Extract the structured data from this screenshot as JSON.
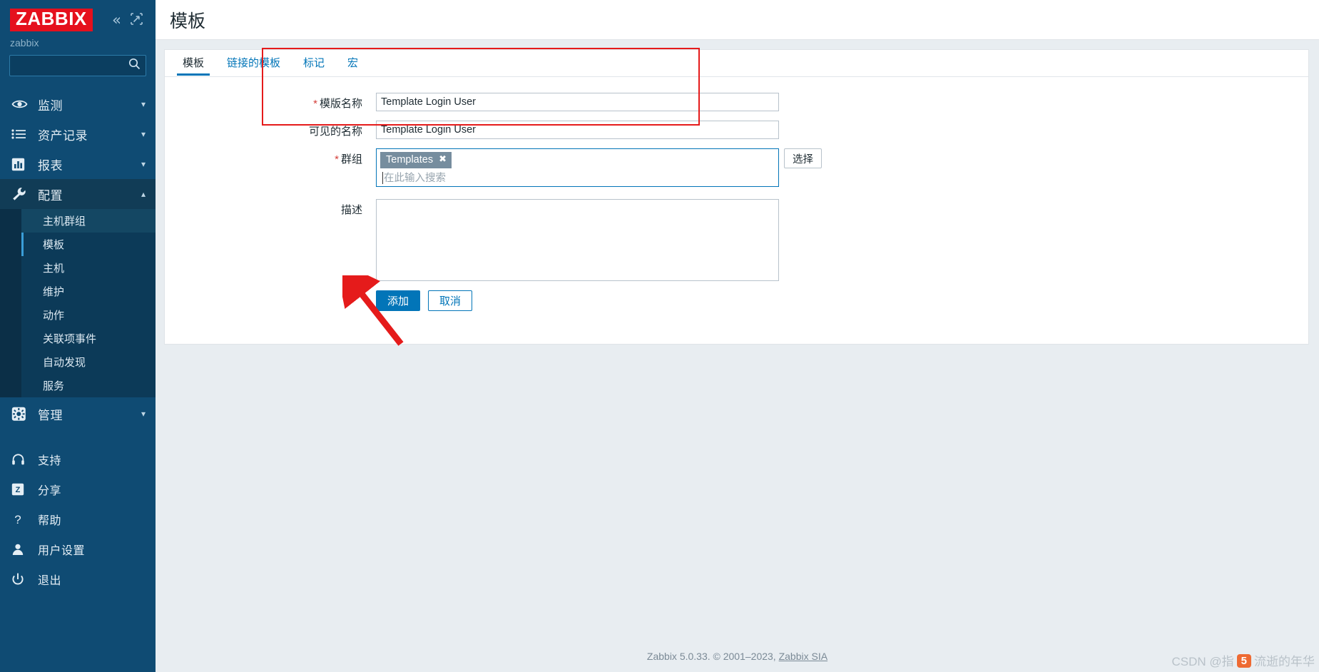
{
  "sidebar": {
    "logo_text": "ZABBIX",
    "collapse_icon": "chevrons-left-icon",
    "expand_icon": "expand-icon",
    "user_label": "zabbix",
    "search_placeholder": "",
    "search_value": "",
    "nav": [
      {
        "label": "监测",
        "icon": "eye-icon",
        "chevron": "chevron-down",
        "active": false
      },
      {
        "label": "资产记录",
        "icon": "list-icon",
        "chevron": "chevron-down",
        "active": false
      },
      {
        "label": "报表",
        "icon": "chart-icon",
        "chevron": "chevron-down",
        "active": false
      },
      {
        "label": "配置",
        "icon": "wrench-icon",
        "chevron": "chevron-up",
        "active": true
      }
    ],
    "subnav": [
      {
        "label": "主机群组",
        "state": "hover"
      },
      {
        "label": "模板",
        "state": "selected"
      },
      {
        "label": "主机",
        "state": ""
      },
      {
        "label": "维护",
        "state": ""
      },
      {
        "label": "动作",
        "state": ""
      },
      {
        "label": "关联项事件",
        "state": ""
      },
      {
        "label": "自动发现",
        "state": ""
      },
      {
        "label": "服务",
        "state": ""
      }
    ],
    "nav_admin": {
      "label": "管理",
      "icon": "gear-icon",
      "chevron": "chevron-down"
    },
    "nav_bottom": [
      {
        "label": "支持",
        "icon": "headset-icon"
      },
      {
        "label": "分享",
        "icon": "zabbix-share-icon"
      },
      {
        "label": "帮助",
        "icon": "question-icon"
      },
      {
        "label": "用户设置",
        "icon": "user-icon"
      },
      {
        "label": "退出",
        "icon": "power-icon"
      }
    ]
  },
  "header": {
    "title": "模板"
  },
  "tabs": [
    {
      "label": "模板",
      "active": true
    },
    {
      "label": "链接的模板",
      "active": false
    },
    {
      "label": "标记",
      "active": false
    },
    {
      "label": "宏",
      "active": false
    }
  ],
  "form": {
    "template_name": {
      "label": "模版名称",
      "required": true,
      "value": "Template Login User",
      "placeholder": ""
    },
    "visible_name": {
      "label": "可见的名称",
      "required": false,
      "value": "Template Login User",
      "placeholder": ""
    },
    "groups": {
      "label": "群组",
      "required": true,
      "chips": [
        "Templates"
      ],
      "chip_remove_icon": "close-icon",
      "placeholder": "在此输入搜索",
      "select_button": "选择"
    },
    "description": {
      "label": "描述",
      "required": false,
      "value": "",
      "placeholder": ""
    },
    "buttons": {
      "submit": "添加",
      "cancel": "取消"
    }
  },
  "annotations": {
    "highlight_color": "#e51b1b",
    "arrow_color": "#e51b1b"
  },
  "footer": {
    "text": "Zabbix 5.0.33. © 2001–2023, ",
    "link": "Zabbix SIA"
  },
  "watermark": {
    "prefix": "CSDN @指",
    "badge": "5",
    "suffix": "流逝的年华"
  },
  "colors": {
    "sidebar_bg": "#0f4b73",
    "accent": "#0275b8",
    "brand_red": "#e5101d",
    "chip_bg": "#768d9e"
  }
}
